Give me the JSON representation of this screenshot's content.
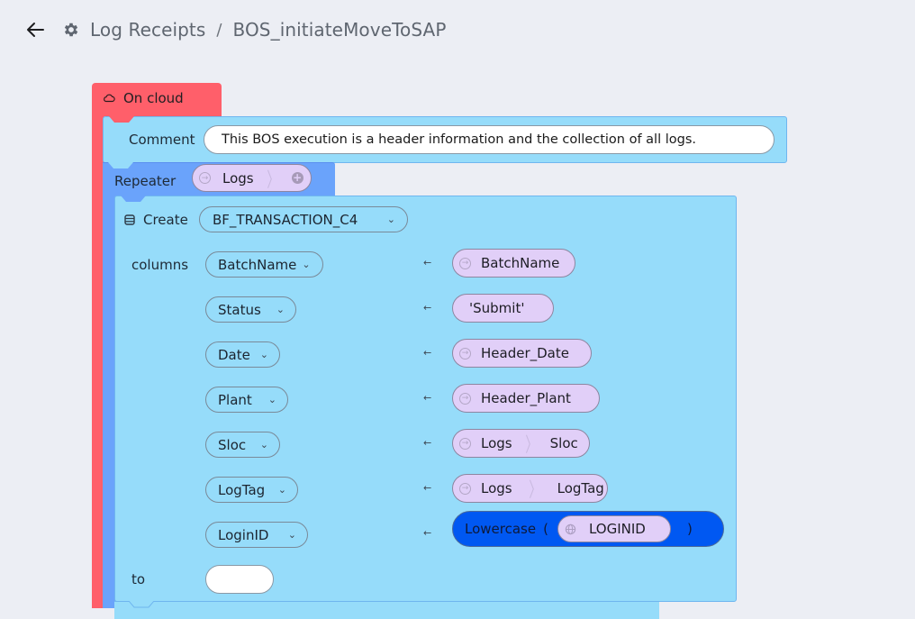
{
  "header": {
    "back_icon": "arrow-left-icon",
    "settings_icon": "gear-icon",
    "breadcrumb": [
      {
        "label": "Log Receipts"
      },
      {
        "label": "BOS_initiateMoveToSAP"
      }
    ],
    "separator": "/"
  },
  "blocks": {
    "on_cloud": {
      "label": "On cloud",
      "icon": "cloud-icon",
      "color": "#ff5f6a"
    },
    "comment": {
      "label": "Comment",
      "value": "This BOS execution is a header information and the collection of all logs.",
      "color": "#96dcfa"
    },
    "repeater": {
      "label": "Repeater",
      "variable": "Logs",
      "color": "#6aa3fb"
    },
    "create": {
      "label": "Create",
      "icon": "database-icon",
      "table": "BF_TRANSACTION_C4",
      "columns_label": "columns",
      "to_label": "to",
      "to_value": "",
      "assign_symbol": "←",
      "caret": "⌄",
      "rows": [
        {
          "column": "BatchName",
          "value_type": "variable",
          "path": [
            "BatchName"
          ]
        },
        {
          "column": "Status",
          "value_type": "literal",
          "value": "'Submit'"
        },
        {
          "column": "Date",
          "value_type": "variable",
          "path": [
            "Header_Date"
          ]
        },
        {
          "column": "Plant",
          "value_type": "variable",
          "path": [
            "Header_Plant"
          ]
        },
        {
          "column": "Sloc",
          "value_type": "variable",
          "path": [
            "Logs",
            "Sloc"
          ]
        },
        {
          "column": "LogTag",
          "value_type": "variable",
          "path": [
            "Logs",
            "LogTag"
          ]
        },
        {
          "column": "LoginID",
          "value_type": "function",
          "function": "Lowercase",
          "open_paren": "(",
          "close_paren": ")",
          "argument": "LOGINID",
          "argument_icon": "globe-icon",
          "color": "#0058f2"
        }
      ]
    }
  }
}
